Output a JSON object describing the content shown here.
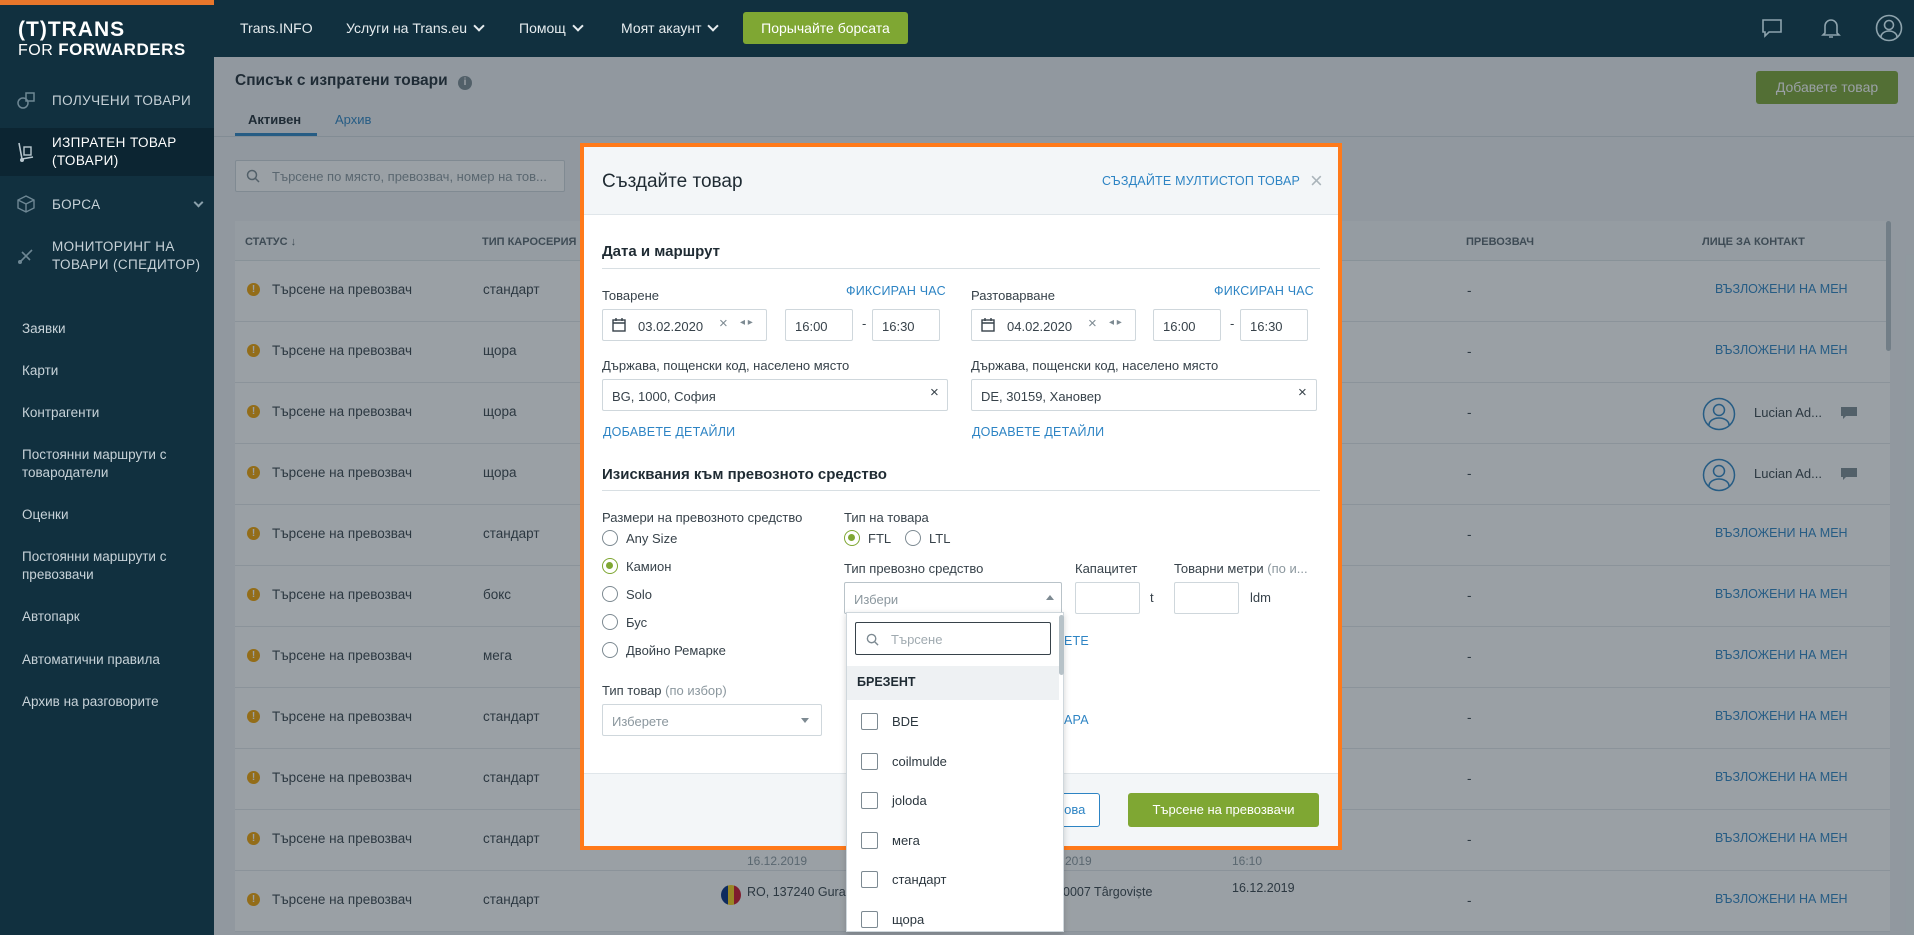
{
  "brand": {
    "line1": "(T)TRANS",
    "line2a": "FOR ",
    "line2b": "FORWARDERS"
  },
  "sidebar": {
    "main": [
      {
        "label": "ПОЛУЧЕНИ ТОВАРИ"
      },
      {
        "label1": "ИЗПРАТЕН ТОВАР",
        "label2": "(ТОВАРИ)"
      },
      {
        "label": "БОРСА"
      },
      {
        "label1": "МОНИТОРИНГ НА",
        "label2": "ТОВАРИ (СПЕДИТОР)"
      }
    ],
    "sub": [
      {
        "label": "Заявки"
      },
      {
        "label": "Карти"
      },
      {
        "label": "Контрагенти"
      },
      {
        "label1": "Постоянни маршрути с",
        "label2": "товародатели"
      },
      {
        "label": "Оценки"
      },
      {
        "label1": "Постоянни маршрути с",
        "label2": "превозвачи"
      },
      {
        "label": "Автопарк"
      },
      {
        "label": "Автоматични правила"
      },
      {
        "label": "Архив на разговорите"
      }
    ]
  },
  "topbar": {
    "items": [
      "Trans.INFO",
      "Услуги на Trans.eu",
      "Помощ",
      "Моят акаунт"
    ],
    "cta": "Порычайте борсата"
  },
  "page": {
    "title": "Списък с изпратени товари",
    "tabs": [
      "Активен",
      "Архив"
    ],
    "add_button": "Добавете товар",
    "search_placeholder": "Търсене по място, превозвач, номер на тов..."
  },
  "table": {
    "headers": [
      "СТАТУС",
      "ТИП КАРОСЕРИЯ",
      "ПРЕВОЗВАЧ",
      "ЛИЦЕ ЗА КОНТАКТ"
    ],
    "rows": [
      {
        "status": "Търсене на превозвач",
        "body": "стандарт",
        "carrier": "-",
        "contact": "ВЪЗЛОЖЕНИ НА МЕН"
      },
      {
        "status": "Търсене на превозвач",
        "body": "щора",
        "carrier": "-",
        "contact": "ВЪЗЛОЖЕНИ НА МЕН"
      },
      {
        "status": "Търсене на превозвач",
        "body": "щора",
        "carrier": "-",
        "contact": "Lucian Ad..."
      },
      {
        "status": "Търсене на превозвач",
        "body": "щора",
        "carrier": "-",
        "contact": "Lucian Ad..."
      },
      {
        "status": "Търсене на превозвач",
        "body": "стандарт",
        "carrier": "-",
        "contact": "ВЪЗЛОЖЕНИ НА МЕН"
      },
      {
        "status": "Търсене на превозвач",
        "body": "бокс",
        "carrier": "-",
        "contact": "ВЪЗЛОЖЕНИ НА МЕН"
      },
      {
        "status": "Търсене на превозвач",
        "body": "мега",
        "carrier": "-",
        "contact": "ВЪЗЛОЖЕНИ НА МЕН"
      },
      {
        "status": "Търсене на превозвач",
        "body": "стандарт",
        "carrier": "-",
        "contact": "ВЪЗЛОЖЕНИ НА МЕН"
      },
      {
        "status": "Търсене на превозвач",
        "body": "стандарт",
        "carrier": "-",
        "contact": "ВЪЗЛОЖЕНИ НА МЕН"
      },
      {
        "status": "Търсене на превозвач",
        "body": "стандарт",
        "carrier": "-",
        "contact": "ВЪЗЛОЖЕНИ НА МЕН",
        "extra1": "16.12.2019",
        "extra2": "2019",
        "extra3": "16:10"
      },
      {
        "status": "Търсене на превозвач",
        "body": "стандарт",
        "carrier": "-",
        "contact": "ВЪЗЛОЖЕНИ НА МЕН",
        "from": "RO, 137240 Gura",
        "to": "0007 Târgoviște",
        "date": "16.12.2019"
      }
    ]
  },
  "modal": {
    "title": "Създайте товар",
    "multistop": "СЪЗДАЙТЕ МУЛТИСТОП ТОВАР",
    "section1": "Дата и маршрут",
    "loading": {
      "label": "Товарене",
      "fixed": "ФИКСИРАН ЧАС",
      "date": "03.02.2020",
      "from": "16:00",
      "to": "16:30",
      "loc_label": "Държава, пощенски код, населено място",
      "loc": "BG, 1000, София",
      "details": "ДОБАВЕТЕ ДЕТАЙЛИ"
    },
    "unloading": {
      "label": "Разтоварване",
      "fixed": "ФИКСИРАН ЧАС",
      "date": "04.02.2020",
      "from": "16:00",
      "to": "16:30",
      "loc_label": "Държава, пощенски код, населено място",
      "loc": "DE, 30159, Хановер",
      "details": "ДОБАВЕТЕ ДЕТАЙЛИ"
    },
    "section2": "Изисквания към превозното средство",
    "sizes_label": "Размери на превозното средство",
    "sizes": [
      "Any Size",
      "Камион",
      "Solo",
      "Бус",
      "Двойно Ремарке"
    ],
    "sizes_selected": "Камион",
    "load_type_label": "Тип на товара",
    "load_types": [
      "FTL",
      "LTL"
    ],
    "load_type_selected": "FTL",
    "vehicle_type_label": "Тип превозно средство",
    "vehicle_type_placeholder": "Избери",
    "capacity_label": "Капацитет",
    "capacity_unit": "t",
    "ldm_label": "Товарни метри",
    "ldm_optional": "(по и...",
    "ldm_unit": "ldm",
    "goods_type_label": "Тип товар",
    "goods_type_optional": "(по избор)",
    "goods_type_placeholder": "Изберете",
    "partial_link1": "ЕТЕ",
    "partial_link2": "АРА",
    "cancel_partial": "нова",
    "submit": "Търсене на превозвачи"
  },
  "dropdown": {
    "search_placeholder": "Търсене",
    "group": "БРЕЗЕНТ",
    "options": [
      "BDE",
      "coilmulde",
      "joloda",
      "мега",
      "стандарт",
      "щора"
    ]
  }
}
